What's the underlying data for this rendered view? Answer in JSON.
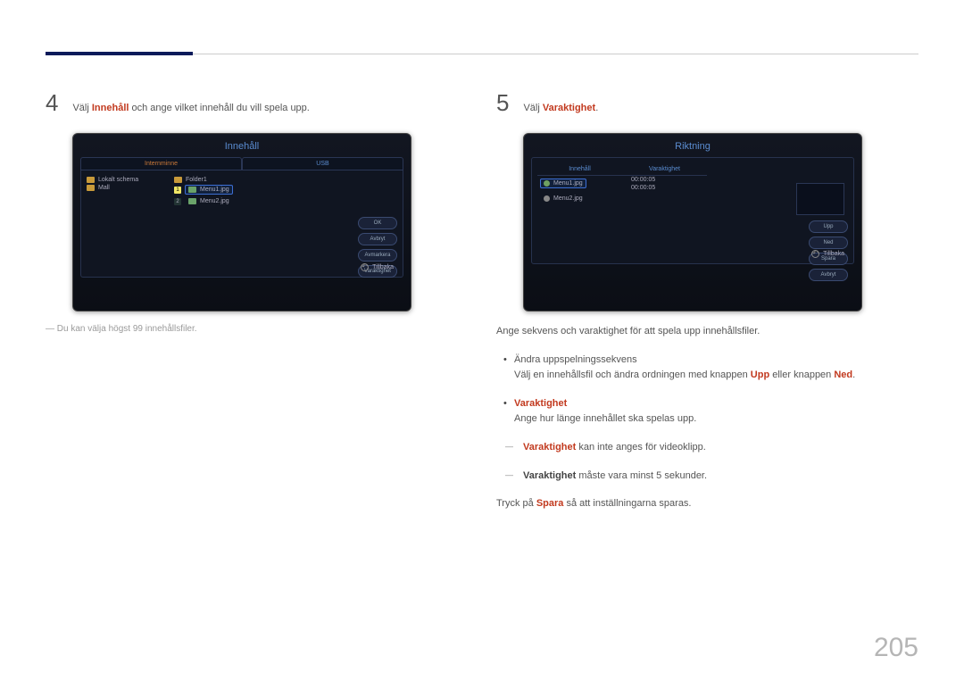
{
  "page_number": "205",
  "left": {
    "step_number": "4",
    "step_text_prefix": "Välj ",
    "step_term": "Innehåll",
    "step_text_suffix": " och ange vilket innehåll du vill spela upp.",
    "note": "Du kan välja högst 99 innehållsfiler.",
    "mock": {
      "title": "Innehåll",
      "tabs": {
        "left": "Internminne",
        "right": "USB"
      },
      "folders": [
        "Lokalt schema",
        "Mall"
      ],
      "usb_folder": "Folder1",
      "files": [
        {
          "num": "1",
          "label": "Menu1.jpg",
          "selected": true
        },
        {
          "num": "2",
          "label": "Menu2.jpg",
          "selected": false
        }
      ],
      "buttons": [
        "OK",
        "Avbryt",
        "Avmarkera",
        "Varaktighet"
      ],
      "back": "Tillbaka"
    }
  },
  "right": {
    "step_number": "5",
    "step_text_prefix": "Välj ",
    "step_term": "Varaktighet",
    "step_text_suffix": ".",
    "mock": {
      "title": "Riktning",
      "col_left": "Innehåll",
      "col_right": "Varaktighet",
      "rows": [
        {
          "label": "Menu1.jpg",
          "dur": "00:00:05",
          "selected": true
        },
        {
          "label": "Menu2.jpg",
          "dur": "00:00:05",
          "selected": false
        }
      ],
      "buttons": [
        "Upp",
        "Ned",
        "Spara",
        "Avbryt"
      ],
      "back": "Tillbaka"
    },
    "body": {
      "intro": "Ange sekvens och varaktighet för att spela upp innehållsfiler.",
      "seq_heading": "Ändra uppspelningssekvens",
      "seq_line_prefix": "Välj en innehållsfil och ändra ordningen med knappen ",
      "seq_btn1": "Upp",
      "seq_mid": " eller knappen ",
      "seq_btn2": "Ned",
      "seq_end": ".",
      "dur_heading": "Varaktighet",
      "dur_desc": "Ange hur länge innehållet ska spelas upp.",
      "dur_note1_term": "Varaktighet",
      "dur_note1_rest": " kan inte anges för videoklipp.",
      "dur_note2_term": "Varaktighet",
      "dur_note2_rest": " måste vara minst 5 sekunder.",
      "save_prefix": "Tryck på ",
      "save_term": "Spara",
      "save_suffix": " så att inställningarna sparas."
    }
  }
}
